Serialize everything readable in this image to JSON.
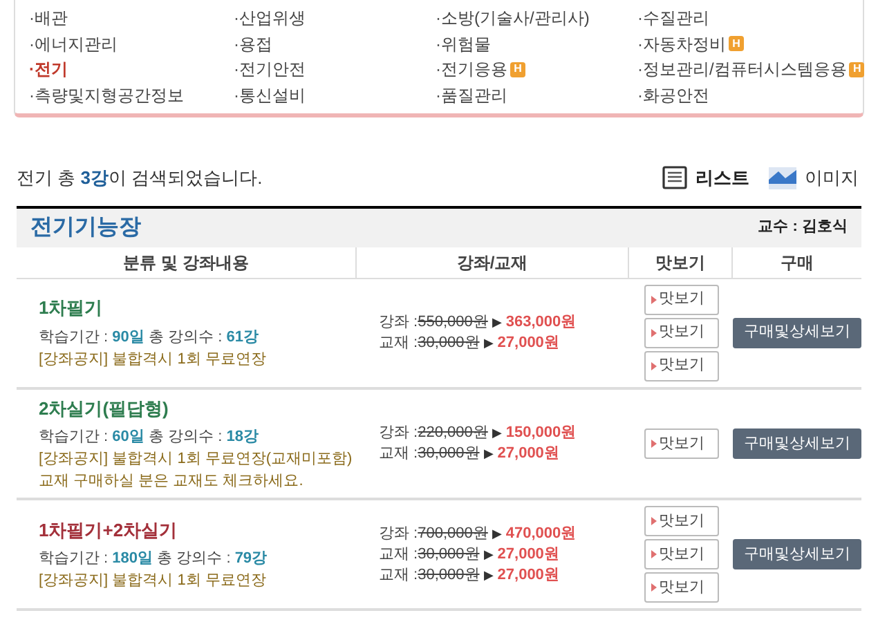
{
  "categories": [
    {
      "label": "·배관",
      "selected": false
    },
    {
      "label": "·산업위생",
      "selected": false
    },
    {
      "label": "·소방(기술사/관리사)",
      "selected": false
    },
    {
      "label": "·수질관리",
      "selected": false
    },
    {
      "label": "·에너지관리",
      "selected": false
    },
    {
      "label": "·용접",
      "selected": false
    },
    {
      "label": "·위험물",
      "selected": false
    },
    {
      "label": "·자동차정비",
      "selected": false,
      "badge": "H"
    },
    {
      "label": "·전기",
      "selected": true
    },
    {
      "label": "·전기안전",
      "selected": false
    },
    {
      "label": "·전기응용",
      "selected": false,
      "badge": "H"
    },
    {
      "label": "·정보관리/컴퓨터시스템응용",
      "selected": false,
      "badge": "H"
    },
    {
      "label": "·측량및지형공간정보",
      "selected": false
    },
    {
      "label": "·통신설비",
      "selected": false
    },
    {
      "label": "·품질관리",
      "selected": false
    },
    {
      "label": "·화공안전",
      "selected": false
    }
  ],
  "result_text": "전기 총 **3강**이 검색되었습니다.",
  "view_toggle": [
    {
      "label": "리스트",
      "selected": true
    },
    {
      "label": "이미지",
      "selected": false
    }
  ],
  "course": {
    "title": "전기기능장",
    "professor": "교수 : 김호식",
    "columns": [
      "분류 및 강좌내용",
      "강좌/교재",
      "맛보기",
      "구매"
    ],
    "rows": [
      {
        "title": "1차필기",
        "color": "#2e7d4f",
        "period": "학습기간 : **90일** 총 강의수 : **61강**",
        "notes": [
          "[강좌공지] 불합격시 1회 무료연장"
        ],
        "prices": [
          {
            "label": "강좌 : ",
            "original": "550,000원",
            "arrow": "▶",
            "sale": "363,000원"
          },
          {
            "label": "교재 : ",
            "original": "30,000원",
            "arrow": "▶",
            "sale": "27,000원"
          }
        ],
        "previews": [
          "맛보기",
          "맛보기",
          "맛보기"
        ],
        "buy": "구매및상세보기"
      },
      {
        "title": "2차실기(필답형)",
        "color": "#2e7d4f",
        "period": "학습기간 : **60일** 총 강의수 : **18강**",
        "notes": [
          "[강좌공지] 불합격시 1회 무료연장(교재미포함)",
          "교재 구매하실 분은 교재도 체크하세요."
        ],
        "prices": [
          {
            "label": "강좌 : ",
            "original": "220,000원",
            "arrow": "▶",
            "sale": "150,000원"
          },
          {
            "label": "교재 : ",
            "original": "30,000원",
            "arrow": "▶",
            "sale": "27,000원"
          }
        ],
        "previews": [
          "맛보기"
        ],
        "buy": "구매및상세보기"
      },
      {
        "title": "1차필기+2차실기",
        "color": "#a3303a",
        "period": "학습기간 : **180일** 총 강의수 : **79강**",
        "notes": [
          "[강좌공지] 불합격시 1회 무료연장"
        ],
        "prices": [
          {
            "label": "강좌 : ",
            "original": "700,000원",
            "arrow": "▶",
            "sale": "470,000원"
          },
          {
            "label": "교재 : ",
            "original": "30,000원",
            "arrow": "▶",
            "sale": "27,000원"
          },
          {
            "label": "교재 : ",
            "original": "30,000원",
            "arrow": "▶",
            "sale": "27,000원"
          }
        ],
        "previews": [
          "맛보기",
          "맛보기",
          "맛보기"
        ],
        "buy": "구매및상세보기"
      }
    ]
  }
}
